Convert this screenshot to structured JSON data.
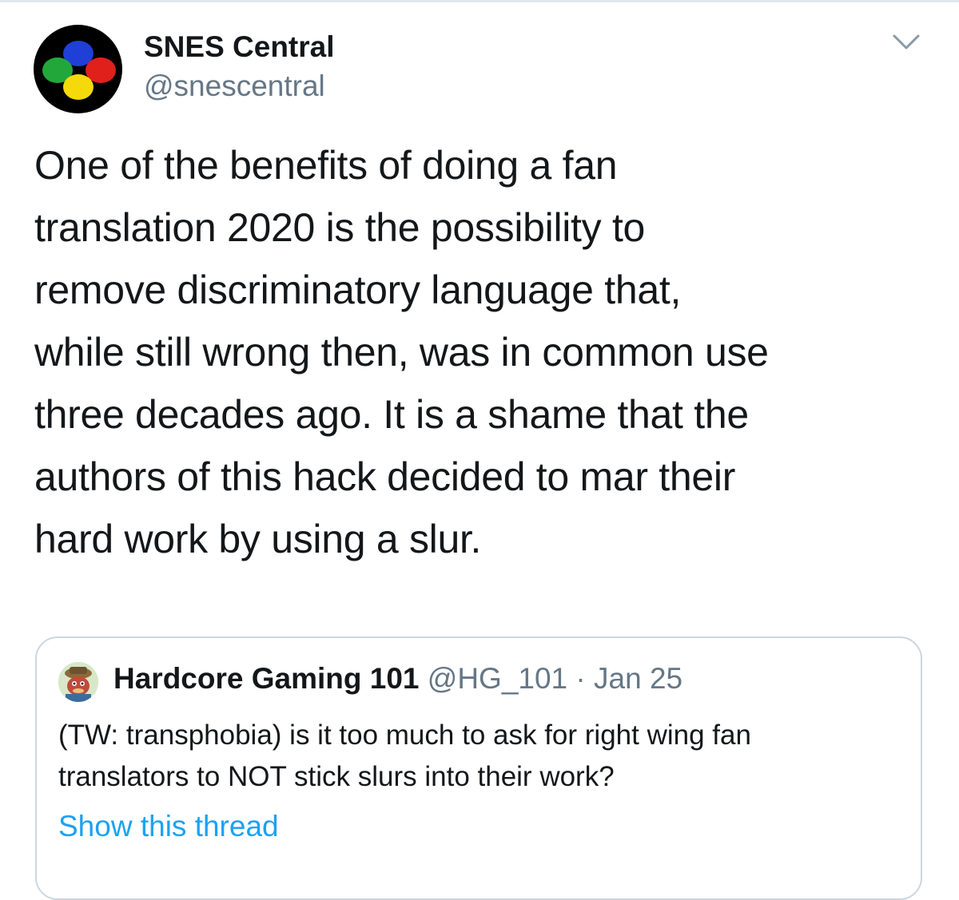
{
  "tweet": {
    "display_name": "SNES Central",
    "handle": "@snescentral",
    "avatar_icon": "snes-controller-buttons-icon",
    "menu_icon": "chevron-down-icon",
    "text_lines": [
      "One of the benefits of doing a fan",
      "translation 2020 is the possibility to",
      "remove discriminatory language that,",
      "while still wrong then, was in common use",
      "three decades ago. It is a shame that the",
      "authors of this hack decided to mar their",
      "hard work by using a slur."
    ]
  },
  "quoted_tweet": {
    "display_name": "Hardcore Gaming 101",
    "handle": "@HG_101",
    "separator": "·",
    "date": "Jan 25",
    "avatar_icon": "mascot-avatar-icon",
    "text_lines": [
      "(TW: transphobia) is it too much to ask for right wing fan",
      "translators to NOT stick slurs into their work?"
    ],
    "show_thread_label": "Show this thread"
  },
  "colors": {
    "primary_text": "#14171a",
    "secondary_text": "#657786",
    "link": "#1da1f2",
    "border": "#ccd6dd"
  }
}
